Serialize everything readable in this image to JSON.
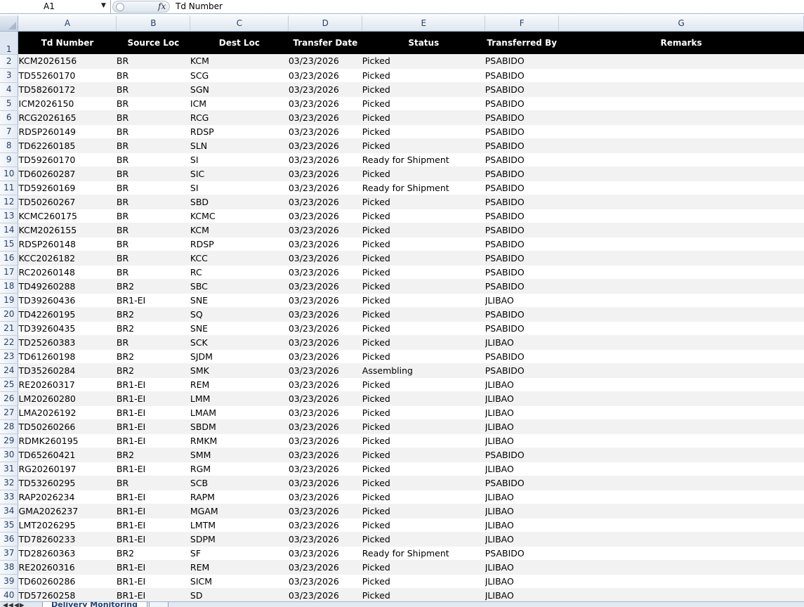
{
  "formula_bar": {
    "name_box": "A1",
    "fx_label": "fx",
    "content": "Td Number"
  },
  "columns": [
    "A",
    "B",
    "C",
    "D",
    "E",
    "F",
    "G"
  ],
  "headers": [
    "Td Number",
    "Source Loc",
    "Dest Loc",
    "Transfer Date",
    "Status",
    "Transferred By",
    "Remarks"
  ],
  "rows": [
    [
      "KCM2026156",
      "BR",
      "KCM",
      "03/23/2026",
      "Picked",
      "PSABIDO",
      ""
    ],
    [
      "TD55260170",
      "BR",
      "SCG",
      "03/23/2026",
      "Picked",
      "PSABIDO",
      ""
    ],
    [
      "TD58260172",
      "BR",
      "SGN",
      "03/23/2026",
      "Picked",
      "PSABIDO",
      ""
    ],
    [
      "ICM2026150",
      "BR",
      "ICM",
      "03/23/2026",
      "Picked",
      "PSABIDO",
      ""
    ],
    [
      "RCG2026165",
      "BR",
      "RCG",
      "03/23/2026",
      "Picked",
      "PSABIDO",
      ""
    ],
    [
      "RDSP260149",
      "BR",
      "RDSP",
      "03/23/2026",
      "Picked",
      "PSABIDO",
      ""
    ],
    [
      "TD62260185",
      "BR",
      "SLN",
      "03/23/2026",
      "Picked",
      "PSABIDO",
      ""
    ],
    [
      "TD59260170",
      "BR",
      "SI",
      "03/23/2026",
      "Ready for Shipment",
      "PSABIDO",
      ""
    ],
    [
      "TD60260287",
      "BR",
      "SIC",
      "03/23/2026",
      "Picked",
      "PSABIDO",
      ""
    ],
    [
      "TD59260169",
      "BR",
      "SI",
      "03/23/2026",
      "Ready for Shipment",
      "PSABIDO",
      ""
    ],
    [
      "TD50260267",
      "BR",
      "SBD",
      "03/23/2026",
      "Picked",
      "PSABIDO",
      ""
    ],
    [
      "KCMC260175",
      "BR",
      "KCMC",
      "03/23/2026",
      "Picked",
      "PSABIDO",
      ""
    ],
    [
      "KCM2026155",
      "BR",
      "KCM",
      "03/23/2026",
      "Picked",
      "PSABIDO",
      ""
    ],
    [
      "RDSP260148",
      "BR",
      "RDSP",
      "03/23/2026",
      "Picked",
      "PSABIDO",
      ""
    ],
    [
      "KCC2026182",
      "BR",
      "KCC",
      "03/23/2026",
      "Picked",
      "PSABIDO",
      ""
    ],
    [
      "RC20260148",
      "BR",
      "RC",
      "03/23/2026",
      "Picked",
      "PSABIDO",
      ""
    ],
    [
      "TD49260288",
      "BR2",
      "SBC",
      "03/23/2026",
      "Picked",
      "PSABIDO",
      ""
    ],
    [
      "TD39260436",
      "BR1-EI",
      "SNE",
      "03/23/2026",
      "Picked",
      "JLIBAO",
      ""
    ],
    [
      "TD42260195",
      "BR2",
      "SQ",
      "03/23/2026",
      "Picked",
      "PSABIDO",
      ""
    ],
    [
      "TD39260435",
      "BR2",
      "SNE",
      "03/23/2026",
      "Picked",
      "PSABIDO",
      ""
    ],
    [
      "TD25260383",
      "BR",
      "SCK",
      "03/23/2026",
      "Picked",
      "JLIBAO",
      ""
    ],
    [
      "TD61260198",
      "BR2",
      "SJDM",
      "03/23/2026",
      "Picked",
      "PSABIDO",
      ""
    ],
    [
      "TD35260284",
      "BR2",
      "SMK",
      "03/23/2026",
      "Assembling",
      "PSABIDO",
      ""
    ],
    [
      "RE20260317",
      "BR1-EI",
      "REM",
      "03/23/2026",
      "Picked",
      "JLIBAO",
      ""
    ],
    [
      "LM20260280",
      "BR1-EI",
      "LMM",
      "03/23/2026",
      "Picked",
      "JLIBAO",
      ""
    ],
    [
      "LMA2026192",
      "BR1-EI",
      "LMAM",
      "03/23/2026",
      "Picked",
      "JLIBAO",
      ""
    ],
    [
      "TD50260266",
      "BR1-EI",
      "SBDM",
      "03/23/2026",
      "Picked",
      "JLIBAO",
      ""
    ],
    [
      "RDMK260195",
      "BR1-EI",
      "RMKM",
      "03/23/2026",
      "Picked",
      "JLIBAO",
      ""
    ],
    [
      "TD65260421",
      "BR2",
      "SMM",
      "03/23/2026",
      "Picked",
      "PSABIDO",
      ""
    ],
    [
      "RG20260197",
      "BR1-EI",
      "RGM",
      "03/23/2026",
      "Picked",
      "JLIBAO",
      ""
    ],
    [
      "TD53260295",
      "BR",
      "SCB",
      "03/23/2026",
      "Picked",
      "PSABIDO",
      ""
    ],
    [
      "RAP2026234",
      "BR1-EI",
      "RAPM",
      "03/23/2026",
      "Picked",
      "JLIBAO",
      ""
    ],
    [
      "GMA2026237",
      "BR1-EI",
      "MGAM",
      "03/23/2026",
      "Picked",
      "JLIBAO",
      ""
    ],
    [
      "LMT2026295",
      "BR1-EI",
      "LMTM",
      "03/23/2026",
      "Picked",
      "JLIBAO",
      ""
    ],
    [
      "TD78260233",
      "BR1-EI",
      "SDPM",
      "03/23/2026",
      "Picked",
      "JLIBAO",
      ""
    ],
    [
      "TD28260363",
      "BR2",
      "SF",
      "03/23/2026",
      "Ready for Shipment",
      "PSABIDO",
      ""
    ],
    [
      "RE20260316",
      "BR1-EI",
      "REM",
      "03/23/2026",
      "Picked",
      "JLIBAO",
      ""
    ],
    [
      "TD60260286",
      "BR1-EI",
      "SICM",
      "03/23/2026",
      "Picked",
      "JLIBAO",
      ""
    ],
    [
      "TD57260258",
      "BR1-EI",
      "SD",
      "03/23/2026",
      "Picked",
      "JLIBAO",
      ""
    ]
  ],
  "sheet_tab": {
    "active": "Delivery Monitoring"
  },
  "colors": {
    "header_bg": "#000000",
    "header_text": "#ffffff",
    "band_odd": "#f2f2f2",
    "grid_header": "#dfe6ef"
  },
  "icons": {
    "fx": "function-icon",
    "name_box_dropdown": "chevron-down-icon"
  }
}
